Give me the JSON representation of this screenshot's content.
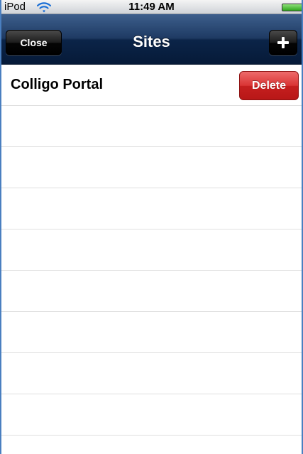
{
  "status_bar": {
    "carrier": "iPod",
    "wifi_icon": "wifi-icon",
    "time": "11:49 AM",
    "battery_icon": "battery-icon",
    "battery_color": "#2fa61c"
  },
  "nav_bar": {
    "title": "Sites",
    "close_label": "Close",
    "add_icon": "plus-icon"
  },
  "sites": [
    {
      "name": "Colligo Portal",
      "delete_label": "Delete"
    }
  ],
  "colors": {
    "nav_bar": "#0b2448",
    "delete_button": "#d93434",
    "row_separator": "#e0e0e0"
  }
}
